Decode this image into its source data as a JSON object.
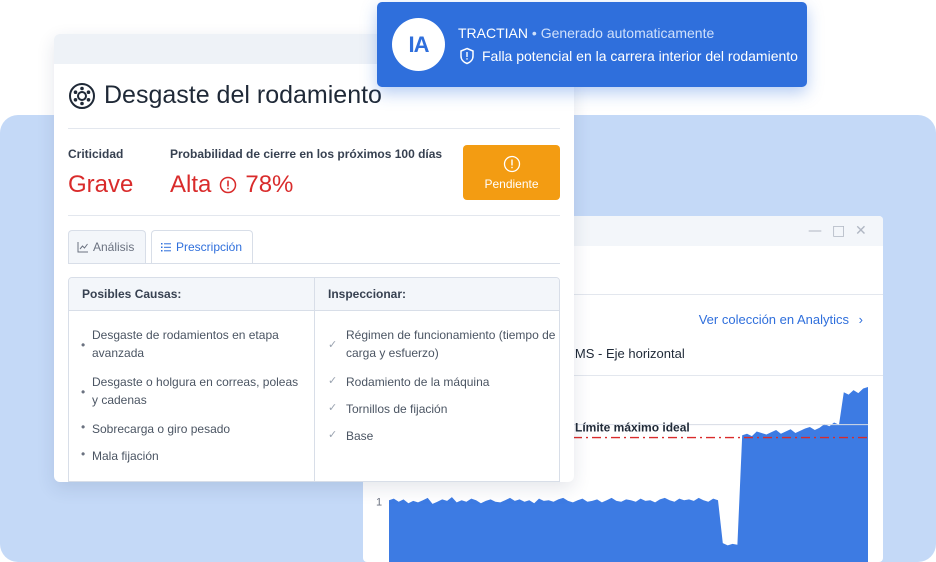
{
  "toast": {
    "logo_text": "IA",
    "source": "TRACTIAN",
    "separator": "•",
    "subtitle": "Generado automaticamente",
    "message": "Falla potencial en la carrera interior del rodamiento",
    "icon": "shield-alert-icon"
  },
  "card": {
    "title": "Desgaste del rodamiento",
    "title_icon": "bearing-icon",
    "criticality_label": "Criticidad",
    "criticality_value": "Grave",
    "probability_label": "Probabilidad de cierre en los próximos 100 días",
    "probability_level": "Alta",
    "probability_percent": "78%",
    "status_button": "Pendiente",
    "tabs": [
      {
        "label": "Análisis",
        "icon": "chart-icon",
        "active": false
      },
      {
        "label": "Prescripción",
        "icon": "list-icon",
        "active": true
      }
    ],
    "causes_header": "Posibles Causas:",
    "inspect_header": "Inspeccionar:",
    "causes": [
      "Desgaste de rodamientos en etapa avanzada",
      "Desgaste o holgura en correas, poleas y cadenas",
      "Sobrecarga o giro pesado",
      "Mala fijación"
    ],
    "inspect": [
      "Régimen de funcionamiento (tiempo de carga y esfuerzo)",
      "Rodamiento de la máquina",
      "Tornillos de fijación",
      "Base"
    ]
  },
  "chart_window": {
    "controls": [
      "—",
      "□",
      "✕"
    ],
    "analytics_link": "Ver colección en Analytics",
    "chart_title_fragment": "dade RMS - Eje horizontal"
  },
  "chart_data": {
    "type": "area",
    "xlabel": "",
    "ylabel": "",
    "y_tick_labels": [
      "1"
    ],
    "threshold_label": "Límite máximo ideal",
    "threshold_value": 1.85,
    "ylim": [
      0.2,
      2.6
    ],
    "colors": {
      "area": "#3d7be3",
      "threshold": "#d92b2b",
      "accent": "#2f6fdc",
      "critical": "#d92b2b",
      "pending": "#f39c12"
    },
    "values": [
      1.02,
      1.04,
      1.0,
      1.03,
      0.98,
      1.01,
      0.99,
      1.02,
      1.05,
      0.97,
      1.0,
      1.03,
      1.01,
      1.06,
      0.99,
      1.02,
      1.0,
      1.04,
      1.02,
      0.98,
      1.01,
      1.03,
      1.0,
      0.99,
      1.02,
      1.05,
      1.01,
      1.03,
      1.0,
      1.02,
      0.98,
      1.04,
      1.01,
      1.02,
      1.0,
      1.03,
      1.05,
      1.01,
      0.99,
      1.02,
      1.04,
      1.0,
      1.01,
      1.03,
      0.99,
      1.02,
      1.05,
      1.01,
      1.0,
      1.03,
      1.02,
      1.0,
      1.04,
      1.01,
      1.02,
      0.99,
      1.03,
      1.05,
      1.02,
      1.0,
      1.04,
      1.02,
      1.03,
      1.01,
      1.05,
      1.02,
      1.0,
      1.04,
      1.02,
      0.45,
      0.42,
      0.44,
      0.43,
      1.88,
      1.9,
      1.87,
      1.93,
      1.91,
      1.89,
      1.92,
      1.95,
      1.9,
      1.93,
      1.96,
      1.91,
      1.94,
      1.97,
      1.99,
      1.95,
      1.98,
      2.03,
      2.0,
      2.05,
      2.02,
      2.45,
      2.42,
      2.48,
      2.44,
      2.5,
      2.52
    ]
  }
}
